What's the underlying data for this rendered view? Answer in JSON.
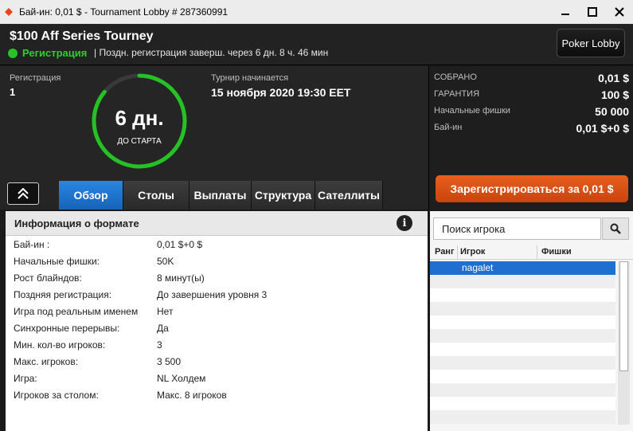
{
  "window": {
    "title": "Бай-ин: 0,01 $ - Tournament Lobby # 287360991",
    "icons": {
      "app": "spade-icon",
      "minimize": "minimize-icon",
      "maximize": "maximize-icon",
      "close": "close-icon"
    }
  },
  "header": {
    "tourney_name": "$100 Aff Series Tourney",
    "status": "Регистрация",
    "late_registration": "| Поздн. регистрация заверш. через 6 дн. 8 ч. 46 мин",
    "poker_lobby_label": "Poker Lobby",
    "status_color": "#28c328"
  },
  "info": {
    "registration_label": "Регистрация",
    "registration_value": "1",
    "countdown_big": "6 дн.",
    "countdown_small": "ДО СТАРТА",
    "start_label": "Турнир начинается",
    "start_value": "15 ноября 2020  19:30 EET",
    "collected_label": "СОБРАНО",
    "collected_value": "0,01 $",
    "guarantee_label": "ГАРАНТИЯ",
    "guarantee_value": "100 $",
    "stack_label": "Начальные фишки",
    "stack_value": "50 000",
    "buyin_label": "Бай-ин",
    "buyin_value": "0,01 $+0 $",
    "register_button": "Зарегистрироваться за  0,01 $",
    "accent_orange": "#e05a1a",
    "accent_blue": "#1f6fd0"
  },
  "tabs": [
    {
      "label": "Обзор",
      "active": true
    },
    {
      "label": "Столы",
      "active": false
    },
    {
      "label": "Выплаты",
      "active": false
    },
    {
      "label": "Структура",
      "active": false
    },
    {
      "label": "Сателлиты",
      "active": false
    }
  ],
  "format": {
    "title": "Информация о формате",
    "rows": [
      {
        "k": "Бай-ин :",
        "v": "0,01 $+0 $"
      },
      {
        "k": "Начальные фишки:",
        "v": "50K"
      },
      {
        "k": "Рост блайндов:",
        "v": "8 минут(ы)"
      },
      {
        "k": "Поздняя регистрация:",
        "v": "До завершения уровня 3"
      },
      {
        "k": "Игра под реальным именем",
        "v": "Нет"
      },
      {
        "k": "Синхронные перерывы:",
        "v": "Да"
      },
      {
        "k": "Мин. кол-во игроков:",
        "v": "3"
      },
      {
        "k": "Макс. игроков:",
        "v": "3 500"
      },
      {
        "k": "Игра:",
        "v": "NL Холдем"
      },
      {
        "k": "Игроков за столом:",
        "v": "Макс. 8 игроков"
      }
    ]
  },
  "players": {
    "search_text": "Поиск игрока",
    "columns": [
      "Ранг",
      "Игрок",
      "Фишки"
    ],
    "rows": [
      {
        "rank": "",
        "name": "nagalet",
        "chips": ""
      }
    ]
  }
}
